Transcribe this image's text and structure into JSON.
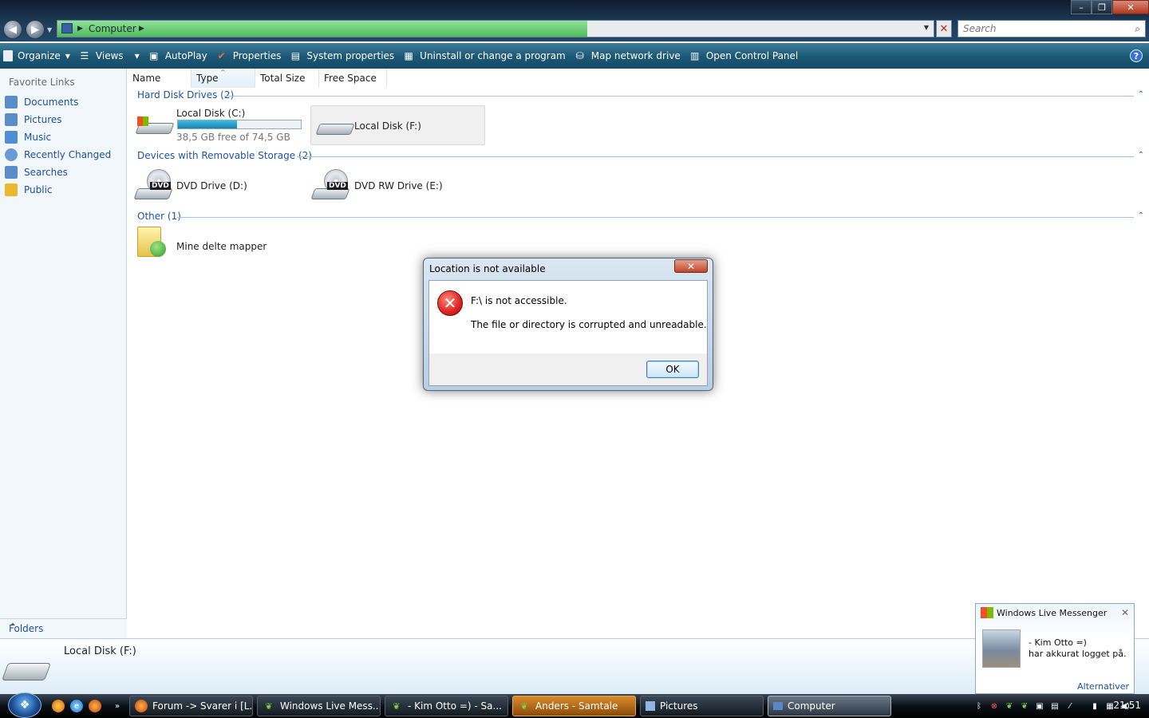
{
  "window": {
    "minimize_glyph": "–",
    "maximize_glyph": "❐",
    "close_glyph": "✕"
  },
  "nav": {
    "back_glyph": "◀",
    "forward_glyph": "▶",
    "breadcrumb": "Computer",
    "search_placeholder": "Search"
  },
  "commands": [
    {
      "label": "Organize",
      "icon": "organize-icon",
      "dropdown": true
    },
    {
      "label": "Views",
      "icon": "views-icon",
      "dropdown": true
    },
    {
      "label": "AutoPlay",
      "icon": "autoplay-icon"
    },
    {
      "label": "Properties",
      "icon": "properties-icon"
    },
    {
      "label": "System properties",
      "icon": "system-properties-icon"
    },
    {
      "label": "Uninstall or change a program",
      "icon": "uninstall-icon"
    },
    {
      "label": "Map network drive",
      "icon": "map-network-drive-icon"
    },
    {
      "label": "Open Control Panel",
      "icon": "control-panel-icon"
    }
  ],
  "sidebar": {
    "title": "Favorite Links",
    "items": [
      {
        "label": "Documents",
        "icon": "documents-icon",
        "color": "#5b8cc7"
      },
      {
        "label": "Pictures",
        "icon": "pictures-icon",
        "color": "#5b8cc7"
      },
      {
        "label": "Music",
        "icon": "music-icon",
        "color": "#4f8ed0"
      },
      {
        "label": "Recently Changed",
        "icon": "recently-changed-icon",
        "color": "#6a9bd4"
      },
      {
        "label": "Searches",
        "icon": "searches-icon",
        "color": "#5b8cc7"
      },
      {
        "label": "Public",
        "icon": "public-folder-icon",
        "color": "#e8b830"
      }
    ],
    "folders_label": "Folders"
  },
  "columns": [
    "Name",
    "Type",
    "Total Size",
    "Free Space"
  ],
  "groups": {
    "hard_disks": {
      "label": "Hard Disk Drives (2)",
      "items": [
        {
          "name": "Local Disk (C:)",
          "free_text": "38,5 GB free of 74,5 GB",
          "used_fraction": 0.48
        },
        {
          "name": "Local Disk (F:)"
        }
      ]
    },
    "removable": {
      "label": "Devices with Removable Storage (2)",
      "items": [
        {
          "name": "DVD Drive (D:)",
          "badge": "DVD"
        },
        {
          "name": "DVD RW Drive (E:)",
          "badge": "DVD"
        }
      ]
    },
    "other": {
      "label": "Other (1)",
      "items": [
        {
          "name": "Mine delte mapper"
        }
      ]
    }
  },
  "details": {
    "title": "Local Disk (F:)"
  },
  "dialog": {
    "title": "Location is not available",
    "message1": "F:\\ is not accessible.",
    "message2": "The file or directory is corrupted and unreadable.",
    "ok_label": "OK"
  },
  "toast": {
    "app": "Windows Live Messenger",
    "contact": "-   Kim Otto =)",
    "message": "har akkurat logget på.",
    "link": "Alternativer"
  },
  "taskbar": {
    "tasks": [
      {
        "label": "Forum -> Svarer i [L...",
        "icon": "firefox-icon",
        "state": "normal"
      },
      {
        "label": "Windows Live Mess...",
        "icon": "messenger-icon",
        "state": "normal"
      },
      {
        "label": "-   Kim Otto =) - Sa...",
        "icon": "messenger-chat-icon",
        "state": "normal"
      },
      {
        "label": "Anders - Samtale",
        "icon": "messenger-chat-icon",
        "state": "flash"
      },
      {
        "label": "Pictures",
        "icon": "folder-icon",
        "state": "normal"
      },
      {
        "label": "Computer",
        "icon": "computer-icon",
        "state": "active"
      }
    ],
    "clock": "21:51"
  }
}
